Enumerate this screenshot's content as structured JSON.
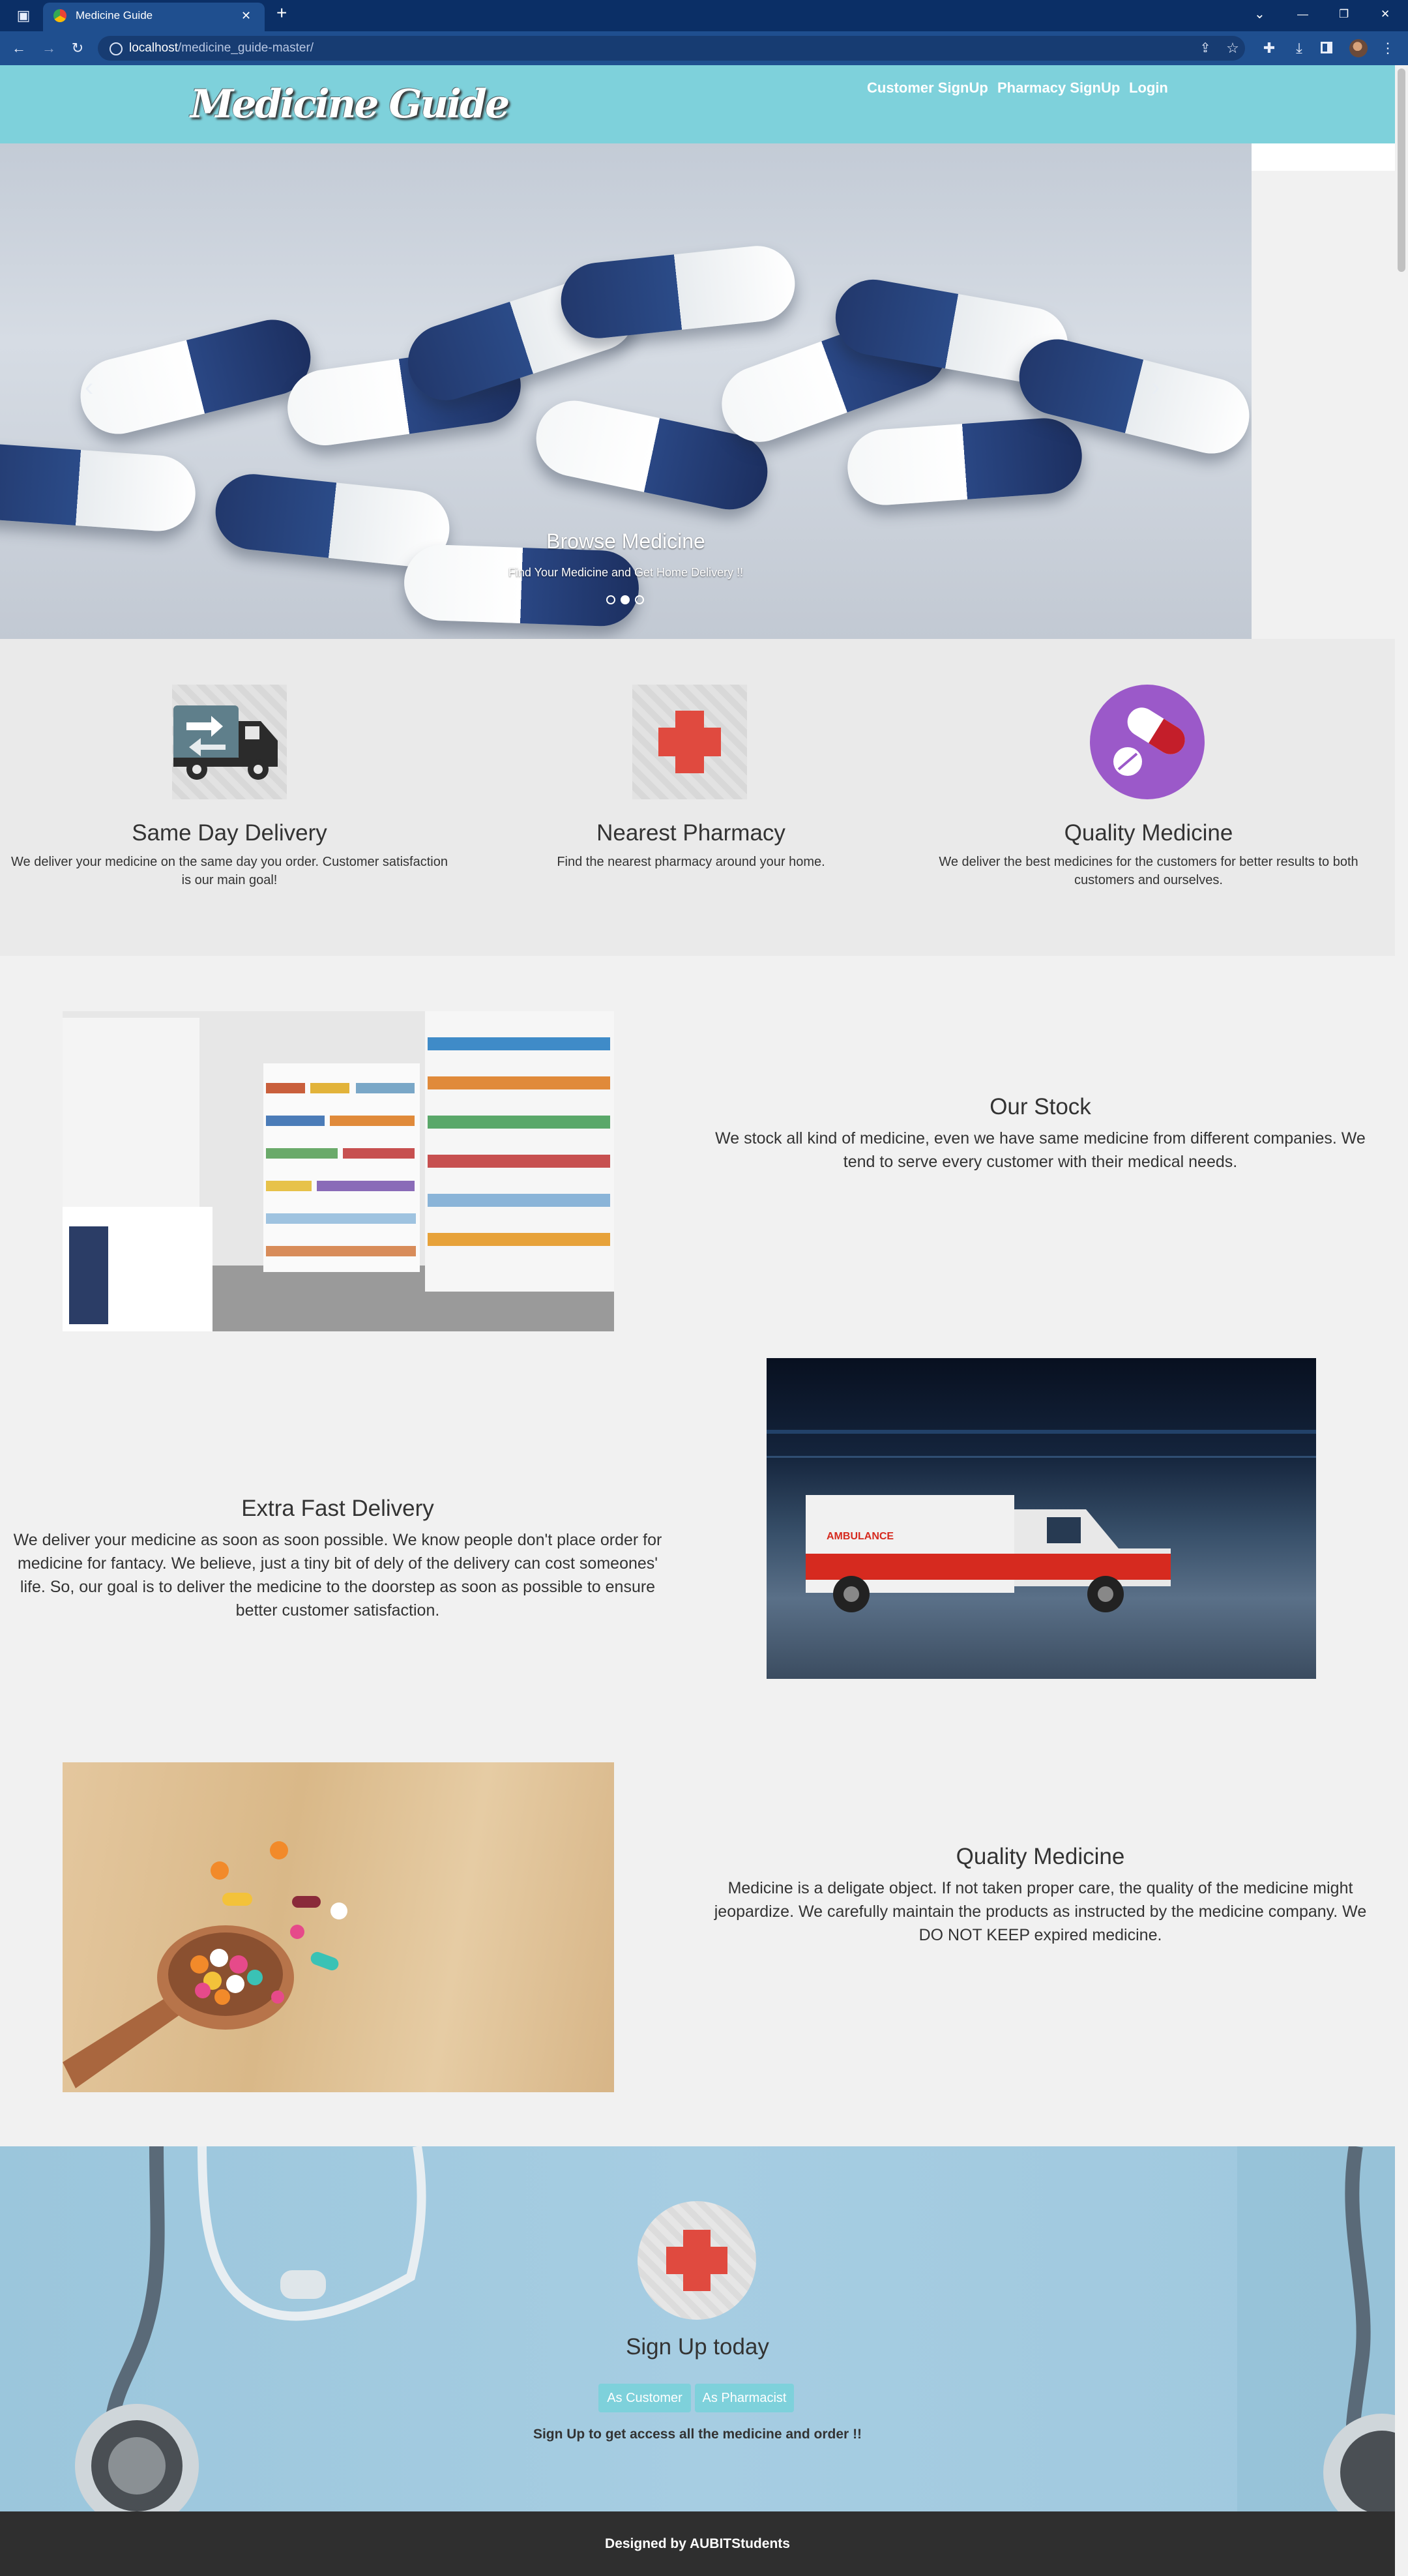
{
  "browser": {
    "tab_title": "Medicine Guide",
    "tab_close": "✕",
    "new_tab": "+",
    "url_host": "localhost",
    "url_path": "/medicine_guide-master/",
    "window_controls": [
      "⌄",
      "—",
      "❐",
      "✕"
    ]
  },
  "navbar": {
    "logo": "Medicine Guide",
    "links": [
      "Customer SignUp",
      "Pharmacy SignUp",
      "Login"
    ]
  },
  "carousel": {
    "title": "Browse Medicine",
    "text": "Find Your Medicine and Get Home Delivery !!",
    "slide_count": 3,
    "active_slide": 2
  },
  "features": [
    {
      "icon": "truck-icon",
      "title": "Same Day Delivery",
      "text": "We deliver your medicine on the same day you order. Customer satisfaction is our main goal!"
    },
    {
      "icon": "red-cross-icon",
      "title": "Nearest Pharmacy",
      "text": "Find the nearest pharmacy around your home."
    },
    {
      "icon": "pill-icon",
      "title": "Quality Medicine",
      "text": "We deliver the best medicines for the customers for better results to both customers and ourselves."
    }
  ],
  "sections": {
    "stock": {
      "title": "Our Stock",
      "text": "We stock all kind of medicine, even we have same medicine from different companies. We tend to serve every customer with their medical needs."
    },
    "delivery": {
      "title": "Extra Fast Delivery",
      "text": "We deliver your medicine as soon as soon possible. We know people don't place order for medicine for fantacy. We believe, just a tiny bit of dely of the delivery can cost someones' life. So, our goal is to deliver the medicine to the doorstep as soon as possible to ensure better customer satisfaction.",
      "ambulance_label": "AMBULANCE"
    },
    "quality": {
      "title": "Quality Medicine",
      "text": "Medicine is a deligate object. If not taken proper care, the quality of the medicine might jeopardize. We carefully maintain the products as instructed by the medicine company. We DO NOT KEEP expired medicine."
    }
  },
  "signup": {
    "title": "Sign Up today",
    "customer_button": "As Customer",
    "pharmacist_button": "As Pharmacist",
    "note": "Sign Up to get access all the medicine and order !!"
  },
  "footer": {
    "text": "Designed by AUBITStudents"
  },
  "colors": {
    "accent": "#7ed1db",
    "footer": "#2f2f2f",
    "chrome": "#0b2f66",
    "cross": "#e04a3f",
    "pill_bg": "#9b59c9"
  }
}
